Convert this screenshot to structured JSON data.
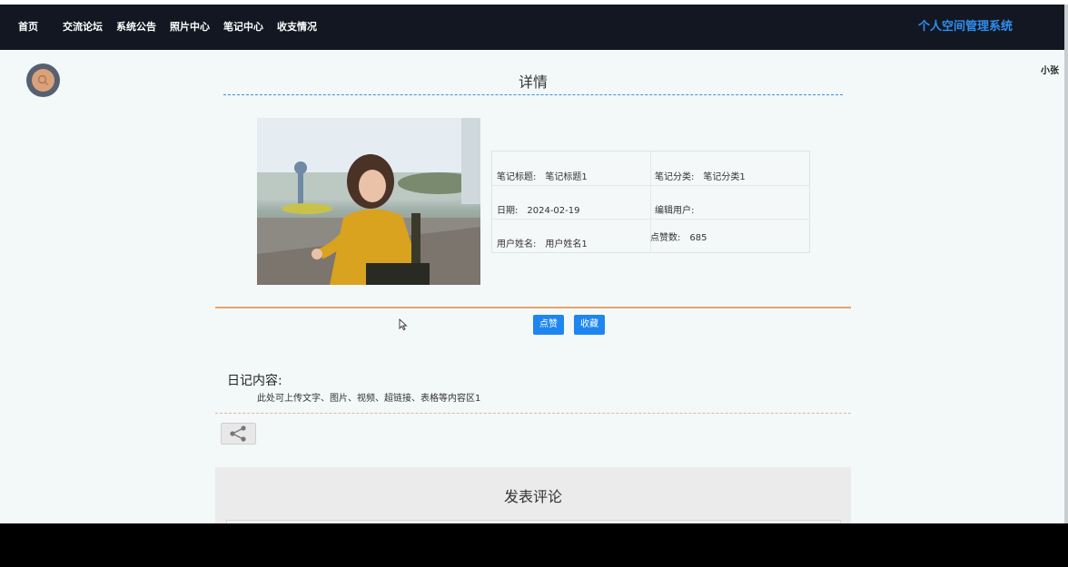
{
  "nav": {
    "items": [
      {
        "label": "首页"
      },
      {
        "label": "交流论坛"
      },
      {
        "label": "系统公告"
      },
      {
        "label": "照片中心"
      },
      {
        "label": "笔记中心"
      },
      {
        "label": "收支情况"
      }
    ],
    "brand": "个人空间管理系统"
  },
  "user": {
    "name": "小张"
  },
  "detail": {
    "title": "详情",
    "fields": {
      "note_title_label": "笔记标题:",
      "note_title_value": "笔记标题1",
      "category_label": "笔记分类:",
      "category_value": "笔记分类1",
      "date_label": "日期:",
      "date_value": "2024-02-19",
      "editor_label": "编辑用户:",
      "editor_value": "",
      "username_label": "用户姓名:",
      "username_value": "用户姓名1",
      "likes_label": "点赞数:",
      "likes_value": "685"
    },
    "buttons": {
      "like": "点赞",
      "favorite": "收藏"
    },
    "diary_label": "日记内容:",
    "diary_text": "此处可上传文字、图片、视频、超链接、表格等内容区1"
  },
  "comment": {
    "title": "发表评论"
  },
  "icons": [
    "search-icon",
    "share-icon"
  ],
  "colors": {
    "nav_bg": "#121722",
    "brand": "#2f8ff0",
    "button": "#1e86f0",
    "accent_line": "#e9a26b"
  }
}
